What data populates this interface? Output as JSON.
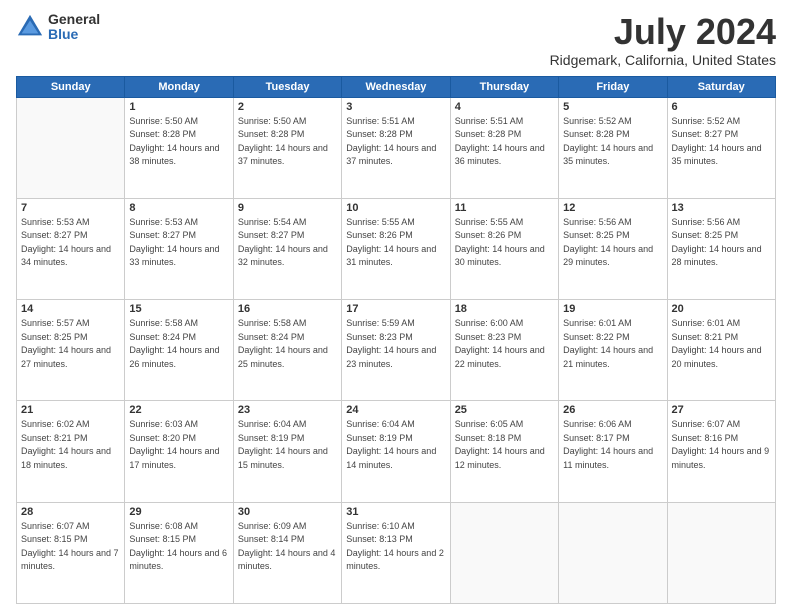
{
  "logo": {
    "general": "General",
    "blue": "Blue"
  },
  "title": "July 2024",
  "subtitle": "Ridgemark, California, United States",
  "headers": [
    "Sunday",
    "Monday",
    "Tuesday",
    "Wednesday",
    "Thursday",
    "Friday",
    "Saturday"
  ],
  "weeks": [
    [
      {
        "day": "",
        "sunrise": "",
        "sunset": "",
        "daylight": ""
      },
      {
        "day": "1",
        "sunrise": "Sunrise: 5:50 AM",
        "sunset": "Sunset: 8:28 PM",
        "daylight": "Daylight: 14 hours and 38 minutes."
      },
      {
        "day": "2",
        "sunrise": "Sunrise: 5:50 AM",
        "sunset": "Sunset: 8:28 PM",
        "daylight": "Daylight: 14 hours and 37 minutes."
      },
      {
        "day": "3",
        "sunrise": "Sunrise: 5:51 AM",
        "sunset": "Sunset: 8:28 PM",
        "daylight": "Daylight: 14 hours and 37 minutes."
      },
      {
        "day": "4",
        "sunrise": "Sunrise: 5:51 AM",
        "sunset": "Sunset: 8:28 PM",
        "daylight": "Daylight: 14 hours and 36 minutes."
      },
      {
        "day": "5",
        "sunrise": "Sunrise: 5:52 AM",
        "sunset": "Sunset: 8:28 PM",
        "daylight": "Daylight: 14 hours and 35 minutes."
      },
      {
        "day": "6",
        "sunrise": "Sunrise: 5:52 AM",
        "sunset": "Sunset: 8:27 PM",
        "daylight": "Daylight: 14 hours and 35 minutes."
      }
    ],
    [
      {
        "day": "7",
        "sunrise": "Sunrise: 5:53 AM",
        "sunset": "Sunset: 8:27 PM",
        "daylight": "Daylight: 14 hours and 34 minutes."
      },
      {
        "day": "8",
        "sunrise": "Sunrise: 5:53 AM",
        "sunset": "Sunset: 8:27 PM",
        "daylight": "Daylight: 14 hours and 33 minutes."
      },
      {
        "day": "9",
        "sunrise": "Sunrise: 5:54 AM",
        "sunset": "Sunset: 8:27 PM",
        "daylight": "Daylight: 14 hours and 32 minutes."
      },
      {
        "day": "10",
        "sunrise": "Sunrise: 5:55 AM",
        "sunset": "Sunset: 8:26 PM",
        "daylight": "Daylight: 14 hours and 31 minutes."
      },
      {
        "day": "11",
        "sunrise": "Sunrise: 5:55 AM",
        "sunset": "Sunset: 8:26 PM",
        "daylight": "Daylight: 14 hours and 30 minutes."
      },
      {
        "day": "12",
        "sunrise": "Sunrise: 5:56 AM",
        "sunset": "Sunset: 8:25 PM",
        "daylight": "Daylight: 14 hours and 29 minutes."
      },
      {
        "day": "13",
        "sunrise": "Sunrise: 5:56 AM",
        "sunset": "Sunset: 8:25 PM",
        "daylight": "Daylight: 14 hours and 28 minutes."
      }
    ],
    [
      {
        "day": "14",
        "sunrise": "Sunrise: 5:57 AM",
        "sunset": "Sunset: 8:25 PM",
        "daylight": "Daylight: 14 hours and 27 minutes."
      },
      {
        "day": "15",
        "sunrise": "Sunrise: 5:58 AM",
        "sunset": "Sunset: 8:24 PM",
        "daylight": "Daylight: 14 hours and 26 minutes."
      },
      {
        "day": "16",
        "sunrise": "Sunrise: 5:58 AM",
        "sunset": "Sunset: 8:24 PM",
        "daylight": "Daylight: 14 hours and 25 minutes."
      },
      {
        "day": "17",
        "sunrise": "Sunrise: 5:59 AM",
        "sunset": "Sunset: 8:23 PM",
        "daylight": "Daylight: 14 hours and 23 minutes."
      },
      {
        "day": "18",
        "sunrise": "Sunrise: 6:00 AM",
        "sunset": "Sunset: 8:23 PM",
        "daylight": "Daylight: 14 hours and 22 minutes."
      },
      {
        "day": "19",
        "sunrise": "Sunrise: 6:01 AM",
        "sunset": "Sunset: 8:22 PM",
        "daylight": "Daylight: 14 hours and 21 minutes."
      },
      {
        "day": "20",
        "sunrise": "Sunrise: 6:01 AM",
        "sunset": "Sunset: 8:21 PM",
        "daylight": "Daylight: 14 hours and 20 minutes."
      }
    ],
    [
      {
        "day": "21",
        "sunrise": "Sunrise: 6:02 AM",
        "sunset": "Sunset: 8:21 PM",
        "daylight": "Daylight: 14 hours and 18 minutes."
      },
      {
        "day": "22",
        "sunrise": "Sunrise: 6:03 AM",
        "sunset": "Sunset: 8:20 PM",
        "daylight": "Daylight: 14 hours and 17 minutes."
      },
      {
        "day": "23",
        "sunrise": "Sunrise: 6:04 AM",
        "sunset": "Sunset: 8:19 PM",
        "daylight": "Daylight: 14 hours and 15 minutes."
      },
      {
        "day": "24",
        "sunrise": "Sunrise: 6:04 AM",
        "sunset": "Sunset: 8:19 PM",
        "daylight": "Daylight: 14 hours and 14 minutes."
      },
      {
        "day": "25",
        "sunrise": "Sunrise: 6:05 AM",
        "sunset": "Sunset: 8:18 PM",
        "daylight": "Daylight: 14 hours and 12 minutes."
      },
      {
        "day": "26",
        "sunrise": "Sunrise: 6:06 AM",
        "sunset": "Sunset: 8:17 PM",
        "daylight": "Daylight: 14 hours and 11 minutes."
      },
      {
        "day": "27",
        "sunrise": "Sunrise: 6:07 AM",
        "sunset": "Sunset: 8:16 PM",
        "daylight": "Daylight: 14 hours and 9 minutes."
      }
    ],
    [
      {
        "day": "28",
        "sunrise": "Sunrise: 6:07 AM",
        "sunset": "Sunset: 8:15 PM",
        "daylight": "Daylight: 14 hours and 7 minutes."
      },
      {
        "day": "29",
        "sunrise": "Sunrise: 6:08 AM",
        "sunset": "Sunset: 8:15 PM",
        "daylight": "Daylight: 14 hours and 6 minutes."
      },
      {
        "day": "30",
        "sunrise": "Sunrise: 6:09 AM",
        "sunset": "Sunset: 8:14 PM",
        "daylight": "Daylight: 14 hours and 4 minutes."
      },
      {
        "day": "31",
        "sunrise": "Sunrise: 6:10 AM",
        "sunset": "Sunset: 8:13 PM",
        "daylight": "Daylight: 14 hours and 2 minutes."
      },
      {
        "day": "",
        "sunrise": "",
        "sunset": "",
        "daylight": ""
      },
      {
        "day": "",
        "sunrise": "",
        "sunset": "",
        "daylight": ""
      },
      {
        "day": "",
        "sunrise": "",
        "sunset": "",
        "daylight": ""
      }
    ]
  ]
}
